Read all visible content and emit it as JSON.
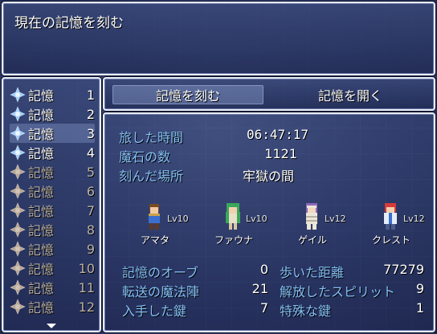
{
  "help": {
    "text": "現在の記憶を刻む"
  },
  "save_list": {
    "items": [
      {
        "label": "記憶",
        "number": "1",
        "active": true
      },
      {
        "label": "記憶",
        "number": "2",
        "active": true
      },
      {
        "label": "記憶",
        "number": "3",
        "active": true,
        "selected": true
      },
      {
        "label": "記憶",
        "number": "4",
        "active": true
      },
      {
        "label": "記憶",
        "number": "5",
        "active": false
      },
      {
        "label": "記憶",
        "number": "6",
        "active": false
      },
      {
        "label": "記憶",
        "number": "7",
        "active": false
      },
      {
        "label": "記憶",
        "number": "8",
        "active": false
      },
      {
        "label": "記憶",
        "number": "9",
        "active": false
      },
      {
        "label": "記憶",
        "number": "10",
        "active": false
      },
      {
        "label": "記憶",
        "number": "11",
        "active": false
      },
      {
        "label": "記憶",
        "number": "12",
        "active": false
      }
    ]
  },
  "tabs": {
    "save": "記憶を刻む",
    "load": "記憶を開く"
  },
  "info": {
    "playtime_label": "旅した時間",
    "playtime": "06:47:17",
    "gold_label": "魔石の数",
    "gold": "1121",
    "location_label": "刻んだ場所",
    "location": "牢獄の間",
    "party": [
      {
        "name": "アマタ",
        "level": "Lv10"
      },
      {
        "name": "ファウナ",
        "level": "Lv10"
      },
      {
        "name": "ゲイル",
        "level": "Lv12"
      },
      {
        "name": "クレスト",
        "level": "Lv12"
      }
    ],
    "stats": [
      {
        "label": "記憶のオーブ",
        "value": "0"
      },
      {
        "label": "転送の魔法陣",
        "value": "21"
      },
      {
        "label": "入手した鍵",
        "value": "7"
      },
      {
        "label": "歩いた距離",
        "value": "77279"
      },
      {
        "label": "解放したスピリット",
        "value": "9"
      },
      {
        "label": "特殊な鍵",
        "value": "1"
      }
    ]
  },
  "colors": {
    "key_text": "#84c0f6",
    "gem_active": "#9fd0ff",
    "gem_inactive": "#b8a48e"
  }
}
